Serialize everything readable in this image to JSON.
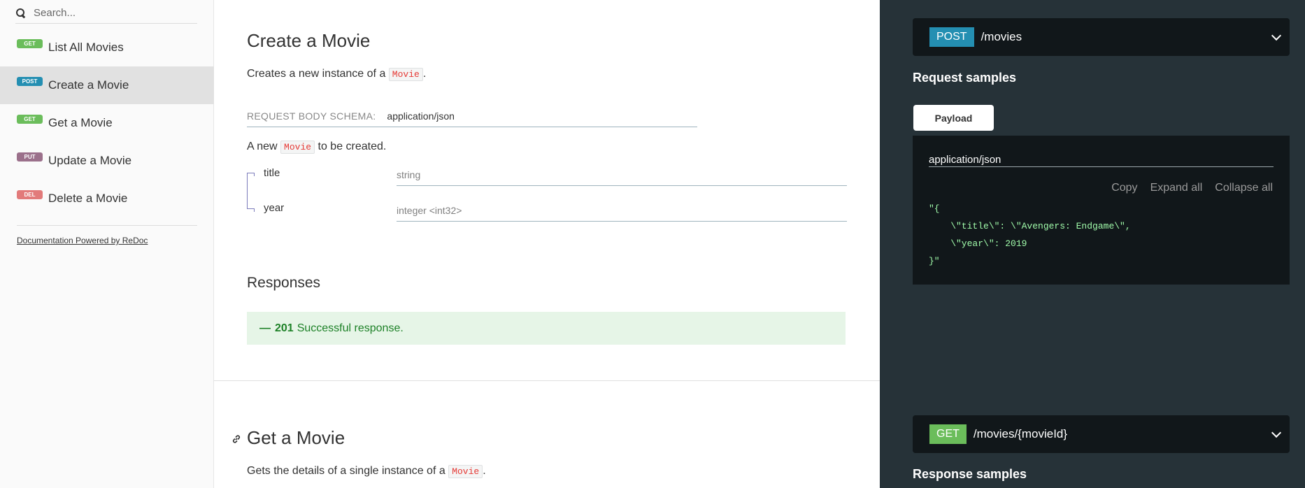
{
  "sidebar": {
    "search_placeholder": "Search...",
    "items": [
      {
        "method": "GET",
        "label": "List All Movies"
      },
      {
        "method": "POST",
        "label": "Create a Movie"
      },
      {
        "method": "GET",
        "label": "Get a Movie"
      },
      {
        "method": "PUT",
        "label": "Update a Movie"
      },
      {
        "method": "DEL",
        "label": "Delete a Movie"
      }
    ],
    "powered_by": "Documentation Powered by ReDoc"
  },
  "create": {
    "title": "Create a Movie",
    "desc_before": "Creates a new instance of a",
    "desc_code": "Movie",
    "desc_after": ".",
    "schema_label": "REQUEST BODY SCHEMA:",
    "schema_type": "application/json",
    "body_before": "A new",
    "body_code": "Movie",
    "body_after": "to be created.",
    "properties": [
      {
        "name": "title",
        "type": "string"
      },
      {
        "name": "year",
        "type": "integer <int32>"
      }
    ],
    "responses_title": "Responses",
    "response": {
      "toggle": "—",
      "code": "201",
      "text": "Successful response."
    }
  },
  "get": {
    "title": "Get a Movie",
    "desc_before": "Gets the details of a single instance of a",
    "desc_code": "Movie",
    "desc_after": "."
  },
  "right": {
    "endpoint1": {
      "method": "POST",
      "path": "/movies"
    },
    "request_samples": "Request samples",
    "payload_tab": "Payload",
    "content_type": "application/json",
    "tools": [
      "Copy",
      "Expand all",
      "Collapse all"
    ],
    "json_sample": "\"{\n    \\\"title\\\": \\\"Avengers: Endgame\\\",\n    \\\"year\\\": 2019\n}\"",
    "endpoint2": {
      "method": "GET",
      "path": "/movies/{movieId}"
    },
    "response_samples": "Response samples"
  },
  "colors": {
    "get": "#6bbd5b",
    "post": "#248fb2",
    "put": "#9b708b",
    "del": "#e27a7a",
    "right_bg": "#263238"
  }
}
